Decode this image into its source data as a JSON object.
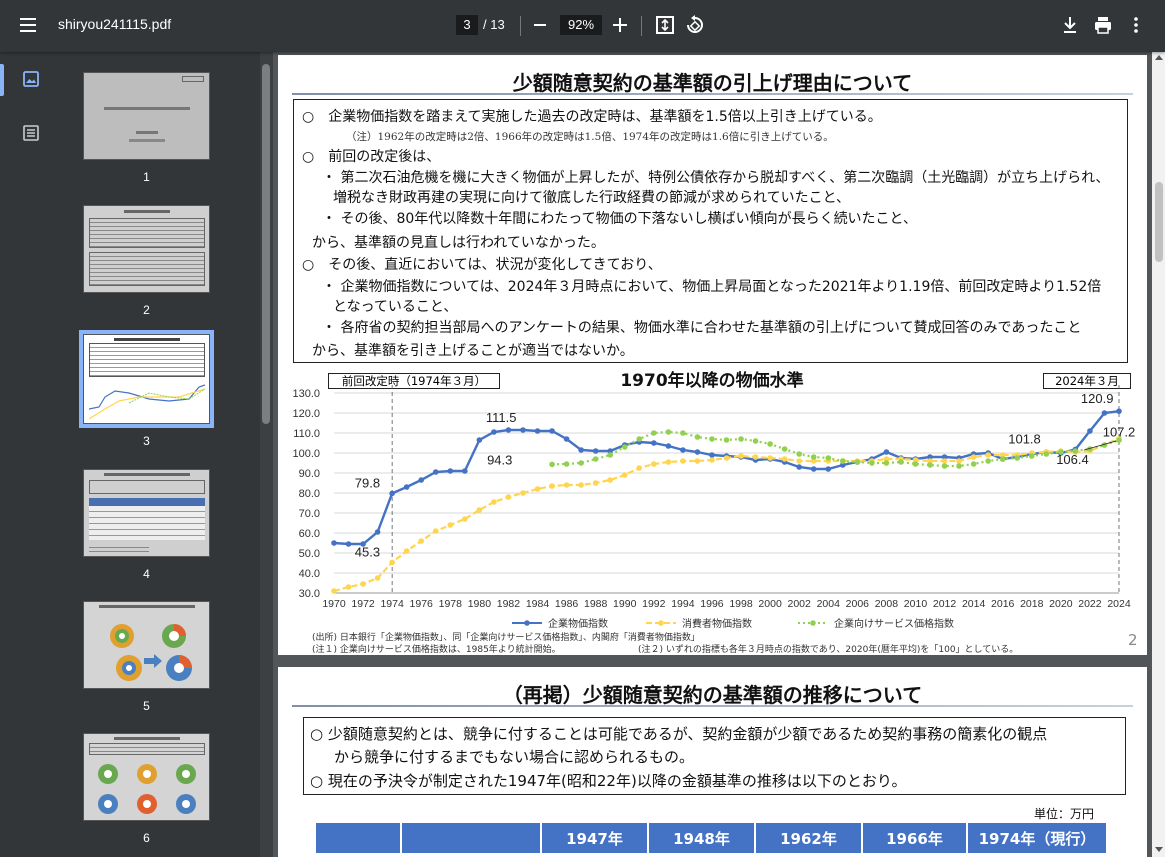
{
  "toolbar": {
    "filename": "shiryou241115.pdf",
    "page_current": "3",
    "page_total": "/ 13",
    "zoom": "92%"
  },
  "sidebar": {
    "thumbnails": [
      {
        "label": "1"
      },
      {
        "label": "2"
      },
      {
        "label": "3"
      },
      {
        "label": "4"
      },
      {
        "label": "5"
      },
      {
        "label": "6"
      }
    ]
  },
  "page2": {
    "title": "少額随意契約の基準額の引上げ理由について",
    "lines": [
      "○　企業物価指数を踏まえて実施した過去の改定時は、基準額を1.5倍以上引き上げている。",
      "（注）1962年の改定時は2倍、1966年の改定時は1.5倍、1974年の改定時は1.6倍に引き上げている。",
      "○　前回の改定後は、",
      "・ 第二次石油危機を機に大きく物価が上昇したが、特例公債依存から脱却すべく、第二次臨調（土光臨調）が立ち上げられ、",
      "増税なき財政再建の実現に向けて徹底した行政経費の節減が求められていたこと、",
      "・ その後、80年代以降数十年間にわたって物価の下落ないし横ばい傾向が長らく続いたこと、",
      "から、基準額の見直しは行われていなかった。",
      "○　その後、直近においては、状況が変化してきており、",
      "・ 企業物価指数については、2024年３月時点において、物価上昇局面となった2021年より1.19倍、前回改定時より1.52倍",
      "となっていること、",
      "・ 各府省の契約担当部局へのアンケートの結果、物価水準に合わせた基準額の引上げについて賛成回答のみであったこと",
      "から、基準額を引き上げることが適当ではないか。"
    ],
    "chart_header_left": "前回改定時（1974年３月）",
    "chart_header_right": "2024年３月",
    "source_lines": [
      "(出所) 日本銀行「企業物価指数」、同「企業向けサービス価格指数」、内閣府「消費者物価指数」",
      "(注１) 企業向けサービス価格指数は、1985年より統計開始。",
      "(注２) いずれの指標も各年３月時点の指数であり、2020年(暦年平均)を「100」としている。"
    ],
    "page_number": "2"
  },
  "page3": {
    "title": "（再掲）少額随意契約の基準額の推移について",
    "lines": [
      "○ 少額随意契約とは、競争に付することは可能であるが、契約金額が少額であるため契約事務の簡素化の観点",
      "から競争に付するまでもない場合に認められるもの。",
      "○ 現在の予決令が制定された1947年(昭和22年)以降の金額基準の推移は以下のとおり。"
    ],
    "unit": "単位：万円",
    "table_headers": [
      "",
      "",
      "1947年",
      "1948年",
      "1962年",
      "1966年",
      "1974年（現行）"
    ]
  },
  "chart_data": {
    "type": "line",
    "title": "1970年以降の物価水準",
    "ylim": [
      30,
      130
    ],
    "yticks": [
      "30.0",
      "40.0",
      "50.0",
      "60.0",
      "70.0",
      "80.0",
      "90.0",
      "100.0",
      "110.0",
      "120.0",
      "130.0"
    ],
    "xticks": [
      "1970",
      "1972",
      "1974",
      "1976",
      "1978",
      "1980",
      "1982",
      "1984",
      "1986",
      "1988",
      "1990",
      "1992",
      "1994",
      "1996",
      "1998",
      "2000",
      "2002",
      "2004",
      "2006",
      "2008",
      "2010",
      "2012",
      "2014",
      "2016",
      "2018",
      "2020",
      "2022",
      "2024"
    ],
    "x": [
      1970,
      1971,
      1972,
      1973,
      1974,
      1975,
      1976,
      1977,
      1978,
      1979,
      1980,
      1981,
      1982,
      1983,
      1984,
      1985,
      1986,
      1987,
      1988,
      1989,
      1990,
      1991,
      1992,
      1993,
      1994,
      1995,
      1996,
      1997,
      1998,
      1999,
      2000,
      2001,
      2002,
      2003,
      2004,
      2005,
      2006,
      2007,
      2008,
      2009,
      2010,
      2011,
      2012,
      2013,
      2014,
      2015,
      2016,
      2017,
      2018,
      2019,
      2020,
      2021,
      2022,
      2023,
      2024
    ],
    "series": [
      {
        "name": "企業物価指数",
        "color": "#4472c4",
        "values": [
          55,
          54.5,
          54.5,
          60.5,
          79.8,
          83,
          86.5,
          90.5,
          91,
          91,
          106.5,
          110.5,
          111.5,
          111.5,
          111,
          111,
          107,
          101.5,
          101,
          101,
          104,
          105.5,
          105,
          103.5,
          101.5,
          100.5,
          99,
          98.5,
          98,
          96.5,
          97,
          95.5,
          93,
          92,
          92,
          94,
          95.5,
          97,
          100.5,
          97.5,
          97,
          98,
          98,
          97.5,
          99.5,
          100,
          97,
          98,
          99.5,
          100.5,
          100,
          101.8,
          111,
          120,
          120.9
        ]
      },
      {
        "name": "消費者物価指数",
        "color": "#ffd54f",
        "values": [
          31,
          33,
          34.5,
          37.5,
          45.3,
          51,
          56,
          61,
          64,
          67,
          71.5,
          75.5,
          78,
          80,
          82,
          83.5,
          84,
          84,
          85,
          86.5,
          89,
          92.5,
          94.5,
          95.5,
          96,
          96,
          96.5,
          97.5,
          98.5,
          98,
          97.5,
          97,
          96,
          96,
          96,
          96,
          96,
          96,
          97,
          97,
          96.5,
          96,
          96,
          96,
          98,
          99,
          99,
          99,
          100,
          100.5,
          101,
          100.5,
          101,
          104,
          107.2
        ]
      },
      {
        "name": "企業向けサービス価格指数",
        "color": "#92d050",
        "values": [
          null,
          null,
          null,
          null,
          null,
          null,
          null,
          null,
          null,
          null,
          null,
          null,
          null,
          null,
          null,
          94.3,
          94.5,
          95,
          97,
          99,
          103,
          107,
          110,
          110.5,
          110,
          108,
          107,
          106.5,
          107,
          106,
          104.5,
          102,
          99.5,
          98,
          97.5,
          96,
          95.5,
          95,
          95,
          95.5,
          94.5,
          94,
          93.5,
          93.5,
          94.5,
          96,
          97,
          97.5,
          98.5,
          99.5,
          100.5,
          101,
          102,
          104,
          106.4
        ]
      }
    ],
    "annotations": [
      "79.8",
      "45.3",
      "111.5",
      "94.3",
      "101.8",
      "120.9",
      "107.2",
      "106.4"
    ]
  }
}
